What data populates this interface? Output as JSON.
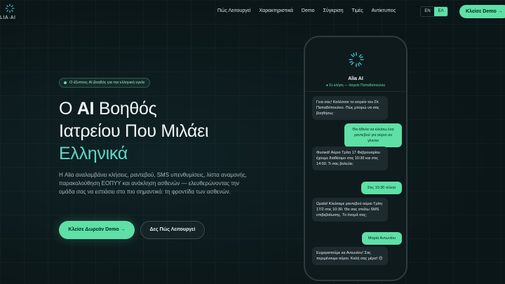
{
  "nav": {
    "brand": "LIA·AI",
    "links": [
      "Πώς Λειτουργεί",
      "Χαρακτηριστικά",
      "Demo",
      "Σύγκριση",
      "Τιμές",
      "Αντίκτυπος"
    ],
    "lang": [
      "EN",
      "ΕΛ"
    ],
    "lang_active": "ΕΛ",
    "cta": "Κλείσε Demo →"
  },
  "hero": {
    "badge": "Ο έξυπνος AI βοηθός για την ελληνική υγεία",
    "title_line1_bold": "AI",
    "title_line1_pre": "Ο ",
    "title_line1_post": " Βοηθός",
    "title_line2": "Ιατρείου Που Μιλάει",
    "title_line3": "Ελληνικά",
    "description": "Η Aliα αναλαμβάνει κλήσεις, ραντεβού, SMS υπενθυμίσεις, λίστα αναμονής, παρακολούθηση ΕΟΠΥΥ και ανάκληση ασθενών — ελευθερώνοντας την ομάδα σας να εστιάσει στο πιο σημαντικό: τη φροντίδα των ασθενών.",
    "primary_cta": "Κλείσε Δωρεάν Demo →",
    "secondary_cta": "Δες Πώς Λειτουργεί"
  },
  "phone": {
    "name": "Alia AI",
    "status": "● Σε κλήση — Ιατρείο Παπαδόπουλου",
    "messages": [
      {
        "from": "ai",
        "text": "Γεια σας! Καλέσατε το ιατρείο του Dr. Παπαδόπουλου. Πώς μπορώ να σας βοηθήσω;"
      },
      {
        "from": "user",
        "text": "Θα ήθελα να κλείσω ένα ραντεβού για αύριο αν γίνεται"
      },
      {
        "from": "ai",
        "text": "Φυσικά! Αύριο Τρίτη 17 Φεβρουαρίου έχουμε διαθέσιμο στις 10:30 και στις 14:00. Τι σας βολεύει;"
      },
      {
        "from": "user",
        "text": "Στις 10:30 τέλεια"
      },
      {
        "from": "ai",
        "text": "Ωραία! Κλείσαμε ραντεβού αύριο Τρίτη 17/2 στις 10:30. Θα σας στείλω SMS επιβεβαίωσης. Το όνομά σας;"
      },
      {
        "from": "user",
        "text": "Μαρία Αντωνίου"
      },
      {
        "from": "ai",
        "text": "Ευχαριστούμε κα Αντωνίου! Σας περιμένουμε αύριο. Καλή σας μέρα! 😊"
      }
    ]
  },
  "colors": {
    "accent": "#5ee0a6",
    "heading_accent": "#5fd8c6",
    "background": "#0b1618"
  }
}
